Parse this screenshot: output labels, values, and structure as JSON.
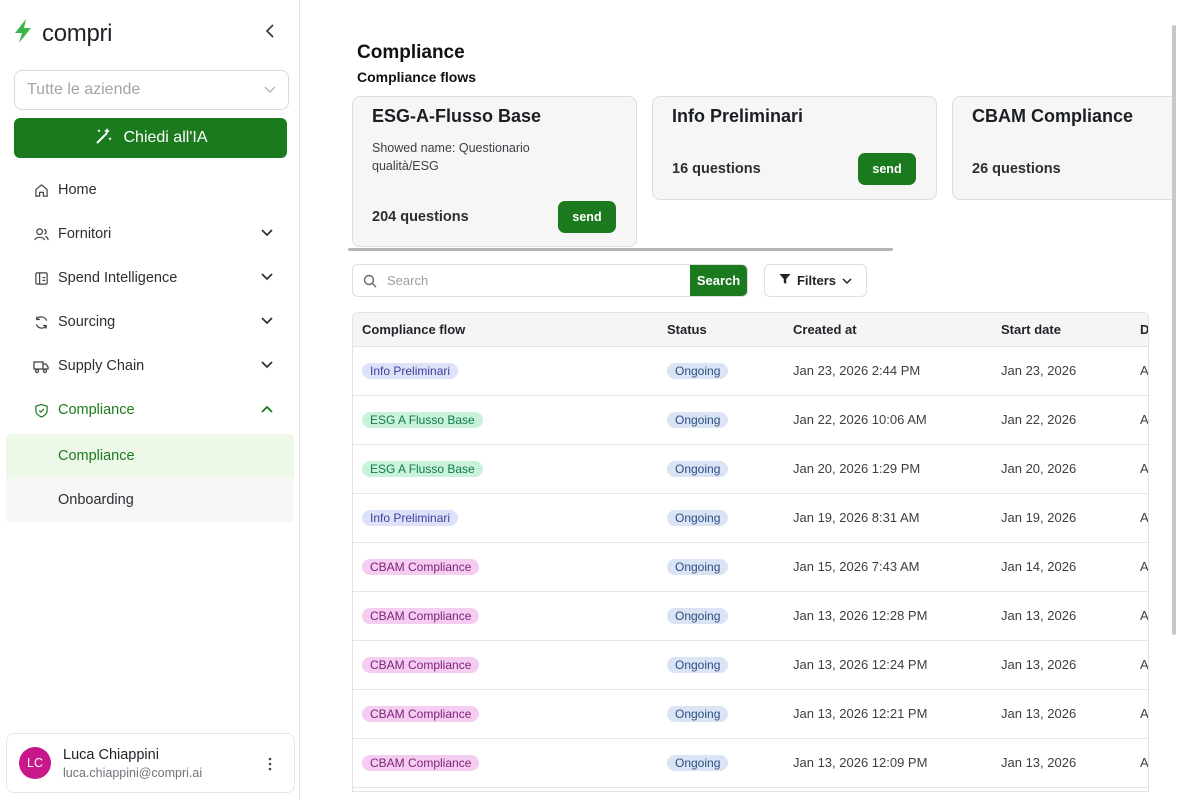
{
  "brand": {
    "name": "compri",
    "logo_icon": "lightning-bolt-icon",
    "accent": "#39b54a"
  },
  "sidebar": {
    "collapse_icon": "chevron-left-icon",
    "company_select": {
      "placeholder": "Tutte le aziende",
      "icon": "chevron-down-icon"
    },
    "ai_button": {
      "label": "Chiedi all'IA",
      "icon": "magic-wand-icon",
      "color": "#1a7a1d"
    },
    "nav": [
      {
        "label": "Home",
        "icon": "home-icon"
      },
      {
        "label": "Fornitori",
        "icon": "users-icon",
        "has_submenu": true
      },
      {
        "label": "Spend Intelligence",
        "icon": "report-icon",
        "has_submenu": true
      },
      {
        "label": "Sourcing",
        "icon": "refresh-icon",
        "has_submenu": true
      },
      {
        "label": "Supply Chain",
        "icon": "truck-icon",
        "has_submenu": true
      },
      {
        "label": "Compliance",
        "icon": "shield-check-icon",
        "has_submenu": true,
        "expanded": true,
        "active": true
      }
    ],
    "subnav": [
      {
        "label": "Compliance",
        "active": true
      },
      {
        "label": "Onboarding"
      }
    ],
    "user": {
      "initials": "LC",
      "name": "Luca Chiappini",
      "email": "luca.chiappini@compri.ai",
      "avatar_color": "#c8168b",
      "menu_icon": "more-vertical-icon"
    }
  },
  "main": {
    "title": "Compliance",
    "subtitle": "Compliance flows",
    "flow_cards": [
      {
        "title": "ESG-A-Flusso Base",
        "description": "Showed name: Questionario qualità/ESG",
        "count": "204 questions",
        "send_label": "send"
      },
      {
        "title": "Info Preliminari",
        "count": "16 questions",
        "send_label": "send"
      },
      {
        "title": "CBAM Compliance",
        "count": "26 questions"
      }
    ],
    "search": {
      "placeholder": "Search",
      "button_label": "Search",
      "icon": "search-icon"
    },
    "filters": {
      "label": "Filters",
      "icon": "filter-icon",
      "chevron": "chevron-down-icon"
    },
    "table": {
      "columns": [
        "Compliance flow",
        "Status",
        "Created at",
        "Start date",
        "D"
      ],
      "rows": [
        {
          "flow": "Info Preliminari",
          "flow_kind": "info",
          "status": "Ongoing",
          "created": "Jan 23, 2026 2:44 PM",
          "start": "Jan 23, 2026",
          "extra": "A"
        },
        {
          "flow": "ESG A Flusso Base",
          "flow_kind": "esg",
          "status": "Ongoing",
          "created": "Jan 22, 2026 10:06 AM",
          "start": "Jan 22, 2026",
          "extra": "A"
        },
        {
          "flow": "ESG A Flusso Base",
          "flow_kind": "esg",
          "status": "Ongoing",
          "created": "Jan 20, 2026 1:29 PM",
          "start": "Jan 20, 2026",
          "extra": "A"
        },
        {
          "flow": "Info Preliminari",
          "flow_kind": "info",
          "status": "Ongoing",
          "created": "Jan 19, 2026 8:31 AM",
          "start": "Jan 19, 2026",
          "extra": "A"
        },
        {
          "flow": "CBAM Compliance",
          "flow_kind": "cbam",
          "status": "Ongoing",
          "created": "Jan 15, 2026 7:43 AM",
          "start": "Jan 14, 2026",
          "extra": "A"
        },
        {
          "flow": "CBAM Compliance",
          "flow_kind": "cbam",
          "status": "Ongoing",
          "created": "Jan 13, 2026 12:28 PM",
          "start": "Jan 13, 2026",
          "extra": "A"
        },
        {
          "flow": "CBAM Compliance",
          "flow_kind": "cbam",
          "status": "Ongoing",
          "created": "Jan 13, 2026 12:24 PM",
          "start": "Jan 13, 2026",
          "extra": "A"
        },
        {
          "flow": "CBAM Compliance",
          "flow_kind": "cbam",
          "status": "Ongoing",
          "created": "Jan 13, 2026 12:21 PM",
          "start": "Jan 13, 2026",
          "extra": "A"
        },
        {
          "flow": "CBAM Compliance",
          "flow_kind": "cbam",
          "status": "Ongoing",
          "created": "Jan 13, 2026 12:09 PM",
          "start": "Jan 13, 2026",
          "extra": "A"
        }
      ]
    }
  }
}
